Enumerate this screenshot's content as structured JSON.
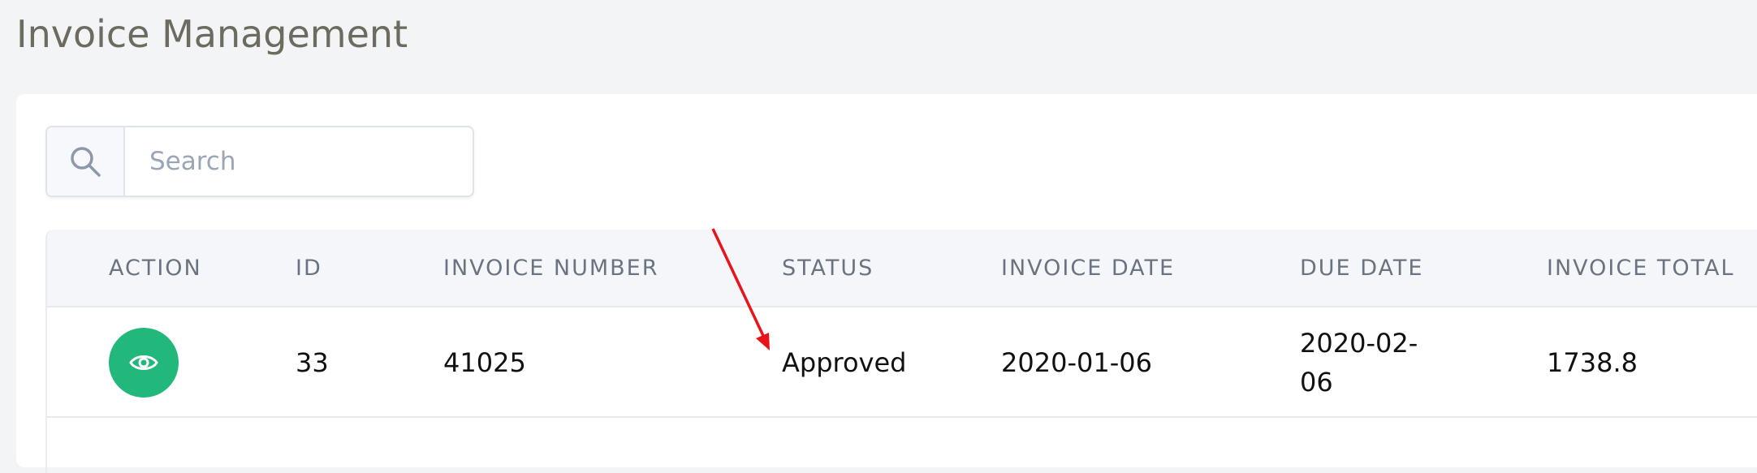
{
  "page": {
    "title": "Invoice Management"
  },
  "search": {
    "placeholder": "Search",
    "icon": "search-icon"
  },
  "table": {
    "headers": {
      "action": "ACTION",
      "id": "ID",
      "invoice_number": "INVOICE NUMBER",
      "status": "STATUS",
      "invoice_date": "INVOICE DATE",
      "due_date": "DUE DATE",
      "invoice_total": "INVOICE TOTAL"
    },
    "rows": [
      {
        "action_icon": "eye-icon",
        "id": "33",
        "invoice_number": "41025",
        "status": "Approved",
        "invoice_date": "2020-01-06",
        "due_date": "2020-02-06",
        "invoice_total": "1738.8"
      }
    ]
  },
  "colors": {
    "view_button": "#22b77b",
    "annotation_arrow": "#e8141b"
  }
}
